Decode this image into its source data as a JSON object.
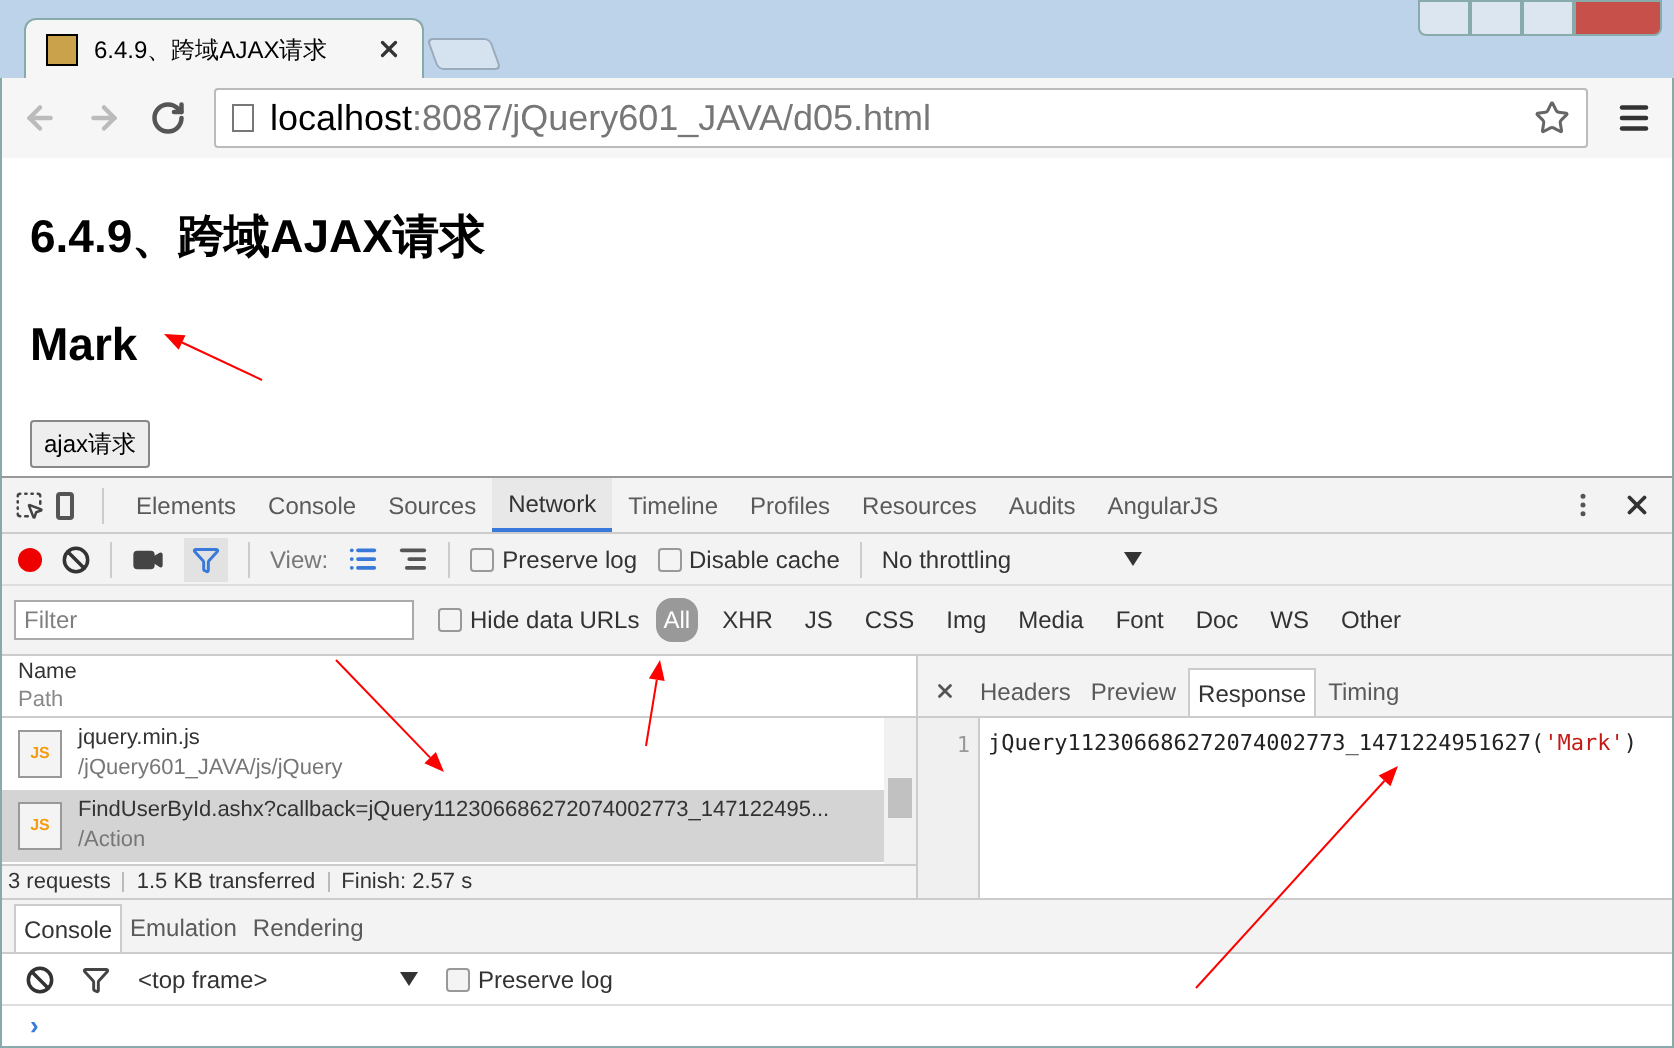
{
  "browser": {
    "tabs": [
      {
        "title": "6.4.9、跨域AJAX请求",
        "selected": true
      }
    ],
    "address": {
      "host": "localhost",
      "path": ":8087/jQuery601_JAVA/d05.html"
    }
  },
  "page": {
    "heading": "6.4.9、跨域AJAX请求",
    "result": "Mark",
    "button": "ajax请求"
  },
  "devtools": {
    "tabs": [
      {
        "label": "Elements",
        "selected": false
      },
      {
        "label": "Console",
        "selected": false
      },
      {
        "label": "Sources",
        "selected": false
      },
      {
        "label": "Network",
        "selected": true
      },
      {
        "label": "Timeline",
        "selected": false
      },
      {
        "label": "Profiles",
        "selected": false
      },
      {
        "label": "Resources",
        "selected": false
      },
      {
        "label": "Audits",
        "selected": false
      },
      {
        "label": "AngularJS",
        "selected": false
      }
    ],
    "toolbar": {
      "recording": true,
      "filter_on": true,
      "view_label": "View:",
      "preserve_log": {
        "label": "Preserve log",
        "checked": false
      },
      "disable_cache": {
        "label": "Disable cache",
        "checked": false
      },
      "throttling": "No throttling"
    },
    "filter_bar": {
      "placeholder": "Filter",
      "hide_data_urls": {
        "label": "Hide data URLs",
        "checked": false
      },
      "types": [
        {
          "label": "All",
          "selected": true
        },
        {
          "label": "XHR",
          "selected": false
        },
        {
          "label": "JS",
          "selected": false
        },
        {
          "label": "CSS",
          "selected": false
        },
        {
          "label": "Img",
          "selected": false
        },
        {
          "label": "Media",
          "selected": false
        },
        {
          "label": "Font",
          "selected": false
        },
        {
          "label": "Doc",
          "selected": false
        },
        {
          "label": "WS",
          "selected": false
        },
        {
          "label": "Other",
          "selected": false
        }
      ]
    },
    "requests": {
      "columns": [
        "Name",
        "Path"
      ],
      "rows": [
        {
          "name": "jquery.min.js",
          "path": "/jQuery601_JAVA/js/jQuery",
          "selected": false,
          "icon_text": "JS"
        },
        {
          "name": "FindUserById.ashx?callback=jQuery112306686272074002773_147122495...",
          "path": "/Action",
          "selected": true,
          "icon_text": "JS"
        }
      ],
      "summary": [
        "3 requests",
        "1.5 KB transferred",
        "Finish: 2.57 s"
      ]
    },
    "detail": {
      "tabs": [
        {
          "label": "Headers",
          "selected": false
        },
        {
          "label": "Preview",
          "selected": false
        },
        {
          "label": "Response",
          "selected": true
        },
        {
          "label": "Timing",
          "selected": false
        }
      ],
      "lines": [
        {
          "number": "1",
          "code": "jQuery112306686272074002773_1471224951627(",
          "string": "'Mark'",
          "end": ")"
        }
      ]
    },
    "drawer": {
      "tabs": [
        {
          "label": "Console",
          "selected": true
        },
        {
          "label": "Emulation",
          "selected": false
        },
        {
          "label": "Rendering",
          "selected": false
        }
      ],
      "context": "<top frame>",
      "preserve_log": {
        "label": "Preserve log",
        "checked": false
      },
      "prompt": "›"
    }
  }
}
